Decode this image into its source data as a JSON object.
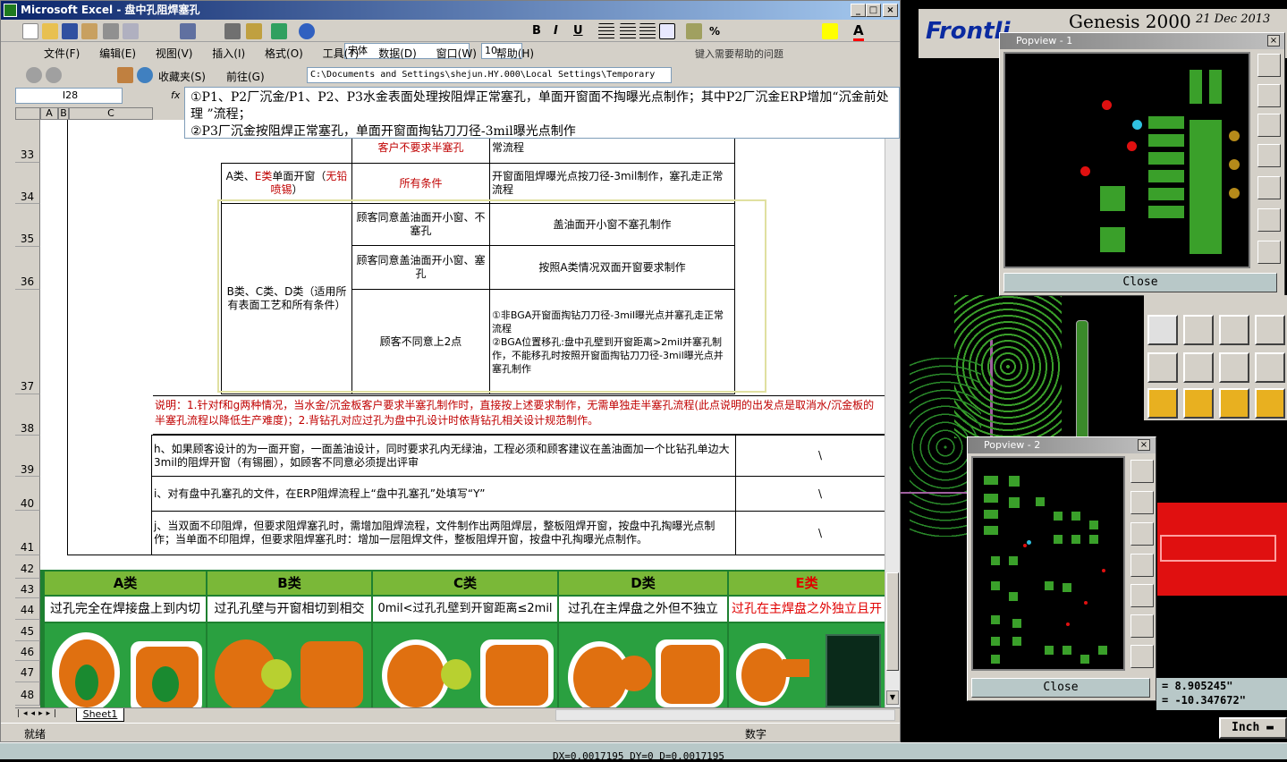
{
  "excel": {
    "title": "Microsoft Excel - 盘中孔阻焊塞孔",
    "font_name": "宋体",
    "font_size": "10",
    "menu": [
      "文件(F)",
      "编辑(E)",
      "视图(V)",
      "插入(I)",
      "格式(O)",
      "工具(T)",
      "数据(D)",
      "窗口(W)",
      "帮助(H)"
    ],
    "help_placeholder": "键入需要帮助的问题",
    "nav_favorites": "收藏夹(S)",
    "nav_go": "前往(G)",
    "address_path": "C:\\Documents and Settings\\shejun.HY.000\\Local Settings\\Temporary",
    "name_box": "I28",
    "fx": "fx",
    "formula_text": "①P1、P2厂沉金/P1、P2、P3水金表面处理按阻焊正常塞孔，单面开窗面不掏曝光点制作；其中P2厂沉金ERP增加“沉金前处理 ”流程；\n②P3厂沉金按阻焊正常塞孔，单面开窗面掏钻刀刀径-3mil曝光点制作",
    "col_headers": [
      "A",
      "B",
      "C"
    ],
    "row_numbers": [
      "33",
      "34",
      "35",
      "36",
      "37",
      "38",
      "39",
      "40",
      "41",
      "42",
      "43",
      "44",
      "45",
      "46",
      "47",
      "48"
    ],
    "sheet_tab": "Sheet1",
    "status_left": "就绪",
    "status_right": "数字"
  },
  "table": {
    "r33_b": "客户不要求半塞孔",
    "r33_c": "常流程",
    "r34_a": "A类、",
    "r34_a_red": "E类",
    "r34_a2": "单面开窗（",
    "r34_a_red2": "无铅喷锡",
    "r34_a3": "）",
    "r34_b": "所有条件",
    "r34_c": "开窗面阻焊曝光点按刀径-3mil制作，塞孔走正常流程",
    "grp_label": "B类、C类、D类（适用所有表面工艺和所有条件）",
    "r35_b": "顾客同意盖油面开小窗、不塞孔",
    "r35_c": "盖油面开小窗不塞孔制作",
    "r36_b": "顾客同意盖油面开小窗、塞孔",
    "r36_c": "按照A类情况双面开窗要求制作",
    "r37_b": "顾客不同意上2点",
    "r37_c1": "①非BGA开窗面掏钻刀刀径-3mil曝光点并塞孔走正常流程",
    "r37_c2": "②BGA位置移孔:盘中孔壁到开窗距离>2mil并塞孔制作，不能移孔时按照开窗面掏钻刀刀径-3mil曝光点并塞孔制作",
    "note": "说明：1.针对f和g两种情况，当水金/沉金板客户要求半塞孔制作时，直接按上述要求制作，无需单独走半塞孔流程(此点说明的出发点是取消水/沉金板的半塞孔流程以降低生产难度)；2.背钻孔对应过孔为盘中孔设计时依背钻孔相关设计规范制作。",
    "h_text": "h、如果顾客设计的为一面开窗，一面盖油设计，同时要求孔内无绿油，工程必须和顾客建议在盖油面加一个比钻孔单边大3mil的阻焊开窗（有锡圈），如顾客不同意必须提出评审",
    "i_text": "i、对有盘中孔塞孔的文件，在ERP阻焊流程上“盘中孔塞孔”处填写“Y”",
    "j_text": "j、当双面不印阻焊，但要求阻焊塞孔时，需增加阻焊流程，文件制作出两阻焊层，整板阻焊开窗，按盘中孔掏曝光点制作；当单面不印阻焊，但要求阻焊塞孔时：增加一层阻焊文件，整板阻焊开窗，按盘中孔掏曝光点制作。",
    "slash": "\\",
    "cat_heads": [
      "A类",
      "B类",
      "C类",
      "D类",
      "E类"
    ],
    "cat_desc": [
      "过孔完全在焊接盘上到内切",
      "过孔孔壁与开窗相切到相交",
      "0mil<过孔孔壁到开窗距离≤2mil",
      "过孔在主焊盘之外但不独立",
      "过孔在主焊盘之外独立且开"
    ]
  },
  "genesis": {
    "brand": "Frontline",
    "app": "Genesis 2000",
    "date": "21 Dec 2013",
    "pop1_title": "Popview - 1",
    "pop2_title": "Popview - 2",
    "close_label": "Close",
    "coord_x": "= 8.905245\"",
    "coord_y": "= -10.347672\"",
    "unit": "Inch",
    "bottom_readout": "DX=0.0017195 DY=0 D=0.0017195"
  },
  "colors": {
    "title_blue": "#0a246a",
    "pcb_green": "#3aa02a",
    "pad_red": "#e01010",
    "highlight_yellow": "#e8e890"
  }
}
